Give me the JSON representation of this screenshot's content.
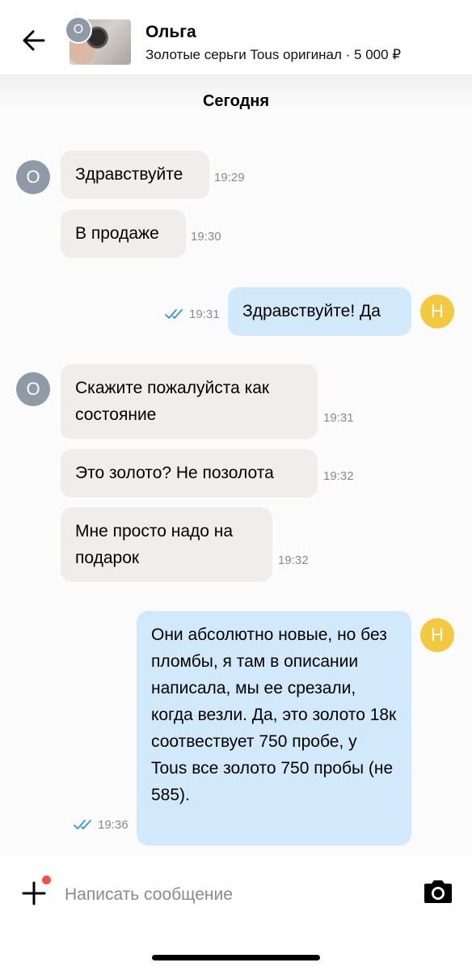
{
  "header": {
    "contact_name": "Ольга",
    "listing_title": "Золотые серьги Tous оригинал · 5 000 ₽",
    "avatar_letter": "О"
  },
  "chat": {
    "date_label": "Сегодня",
    "messages": [
      {
        "direction": "in",
        "text": "Здравствуйте",
        "time": "19:29"
      },
      {
        "direction": "in",
        "text": "В продаже",
        "time": "19:30"
      },
      {
        "direction": "out",
        "text": "Здравствуйте! Да",
        "time": "19:31",
        "read": true
      },
      {
        "direction": "in",
        "text": "Скажите пожалуйста как состояние",
        "time": "19:31"
      },
      {
        "direction": "in",
        "text": "Это золото?  Не позолота",
        "time": "19:32"
      },
      {
        "direction": "in",
        "text": "Мне просто надо на подарок",
        "time": "19:32"
      },
      {
        "direction": "out",
        "text": "Они абсолютно новые, но без пломбы, я там в описании написала, мы ее срезали, когда везли. Да, это золото 18к соотвествует 750 пробе, у Tous все золото 750 пробы (не 585).",
        "time": "19:36",
        "read": true
      }
    ],
    "avatars": {
      "incoming": "О",
      "outgoing": "Н"
    }
  },
  "composer": {
    "placeholder": "Написать сообщение",
    "value": ""
  },
  "colors": {
    "incoming_bubble": "#efeeeb",
    "outgoing_bubble": "#d2e9fb",
    "incoming_avatar": "#8e9aa5",
    "outgoing_avatar": "#f3c942",
    "read_ticks": "#3d8fe0",
    "notification_dot": "#f2524a"
  },
  "icons": [
    "arrow-left-icon",
    "plus-icon",
    "camera-icon",
    "double-check-icon"
  ]
}
